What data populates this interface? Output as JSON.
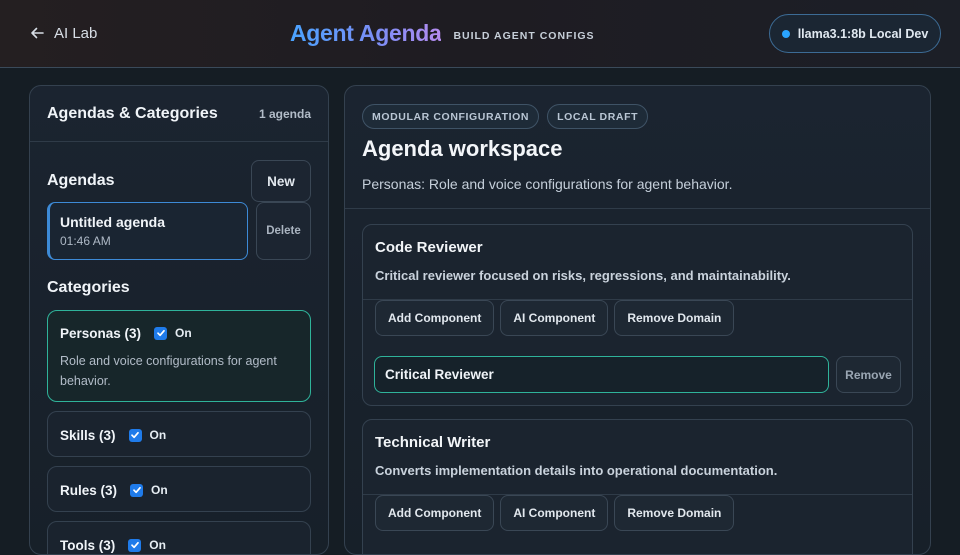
{
  "header": {
    "back_label": "AI Lab",
    "title": "Agent Agenda",
    "subtitle": "BUILD AGENT CONFIGS",
    "model_label": "llama3.1:8b Local Dev",
    "colors": {
      "accent_blue": "#2aa4ff",
      "accent_teal": "#2fb39a"
    }
  },
  "sidebar": {
    "title": "Agendas & Categories",
    "count": "1 agenda",
    "agendas_title": "Agendas",
    "new_label": "New",
    "delete_label": "Delete",
    "agenda": {
      "name": "Untitled agenda",
      "time": "01:46 AM"
    },
    "categories_title": "Categories",
    "categories": [
      {
        "name": "Personas (3)",
        "on": "On",
        "desc": "Role and voice configurations for agent behavior."
      },
      {
        "name": "Skills (3)",
        "on": "On"
      },
      {
        "name": "Rules (3)",
        "on": "On"
      },
      {
        "name": "Tools (3)",
        "on": "On"
      }
    ]
  },
  "workspace": {
    "tags": [
      "MODULAR CONFIGURATION",
      "LOCAL DRAFT"
    ],
    "title": "Agenda workspace",
    "desc": "Personas: Role and voice configurations for agent behavior.",
    "domains": [
      {
        "name": "Code Reviewer",
        "desc": "Critical reviewer focused on risks, regressions, and maintainability.",
        "actions": [
          "Add Component",
          "AI Component",
          "Remove Domain"
        ],
        "component_value": "Critical Reviewer",
        "remove_label": "Remove"
      },
      {
        "name": "Technical Writer",
        "desc": "Converts implementation details into operational documentation.",
        "actions": [
          "Add Component",
          "AI Component",
          "Remove Domain"
        ]
      }
    ]
  }
}
